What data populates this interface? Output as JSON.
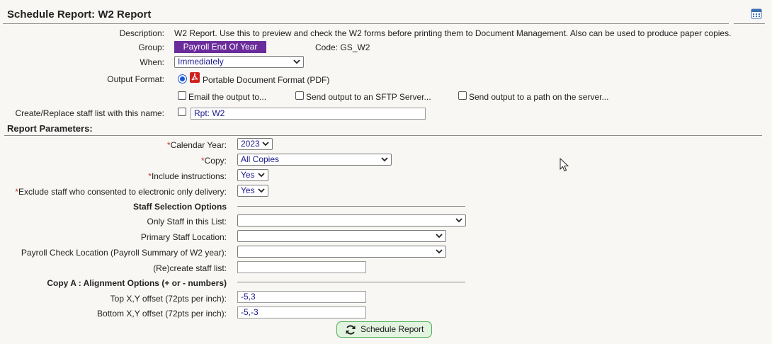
{
  "header": {
    "title": "Schedule Report: W2 Report"
  },
  "form": {
    "description_label": "Description:",
    "description": "W2 Report. Use this to preview and check the W2 forms before printing them to Document Management. Also can be used to produce paper copies.",
    "group_label": "Group:",
    "group": "Payroll End Of Year",
    "code": "Code: GS_W2",
    "when_label": "When:",
    "when": "Immediately",
    "output_format_label": "Output Format:",
    "output_format": "Portable Document Format (PDF)",
    "email_option": "Email the output to...",
    "sftp_option": "Send output to an SFTP Server...",
    "path_option": "Send output to a path on the server...",
    "staff_list_label": "Create/Replace staff list with this name:",
    "staff_list_value": "Rpt: W2"
  },
  "parameters": {
    "heading": "Report Parameters:",
    "required_mark": "*",
    "calendar_year_label": "Calendar Year:",
    "calendar_year": "2023",
    "copy_label": "Copy:",
    "copy": "All Copies",
    "include_instructions_label": "Include instructions:",
    "include_instructions": "Yes",
    "exclude_staff_label": "Exclude staff who consented to electronic only delivery:",
    "exclude_staff": "Yes"
  },
  "staff_selection": {
    "heading": "Staff Selection Options",
    "only_staff_label": "Only Staff in this List:",
    "only_staff": "",
    "primary_location_label": "Primary Staff Location:",
    "primary_location": "",
    "payroll_check_location_label": "Payroll Check Location (Payroll Summary of W2 year):",
    "payroll_check_location": "",
    "recreate_label": "(Re)create staff list:",
    "recreate": ""
  },
  "alignment": {
    "heading": "Copy A : Alignment Options (+ or - numbers)",
    "top_label": "Top X,Y offset (72pts per inch):",
    "top": "-5,3",
    "bottom_label": "Bottom X,Y offset (72pts per inch):",
    "bottom": "-5,-3"
  },
  "actions": {
    "schedule_button": "Schedule Report"
  },
  "icons": {
    "calendar": "calendar-icon",
    "pdf": "pdf-icon",
    "refresh": "refresh-icon",
    "chevron": "chevron-down-icon"
  },
  "colors": {
    "group_badge": "#6a2c9b",
    "required": "#c0392b",
    "button_border": "#4caf50"
  }
}
